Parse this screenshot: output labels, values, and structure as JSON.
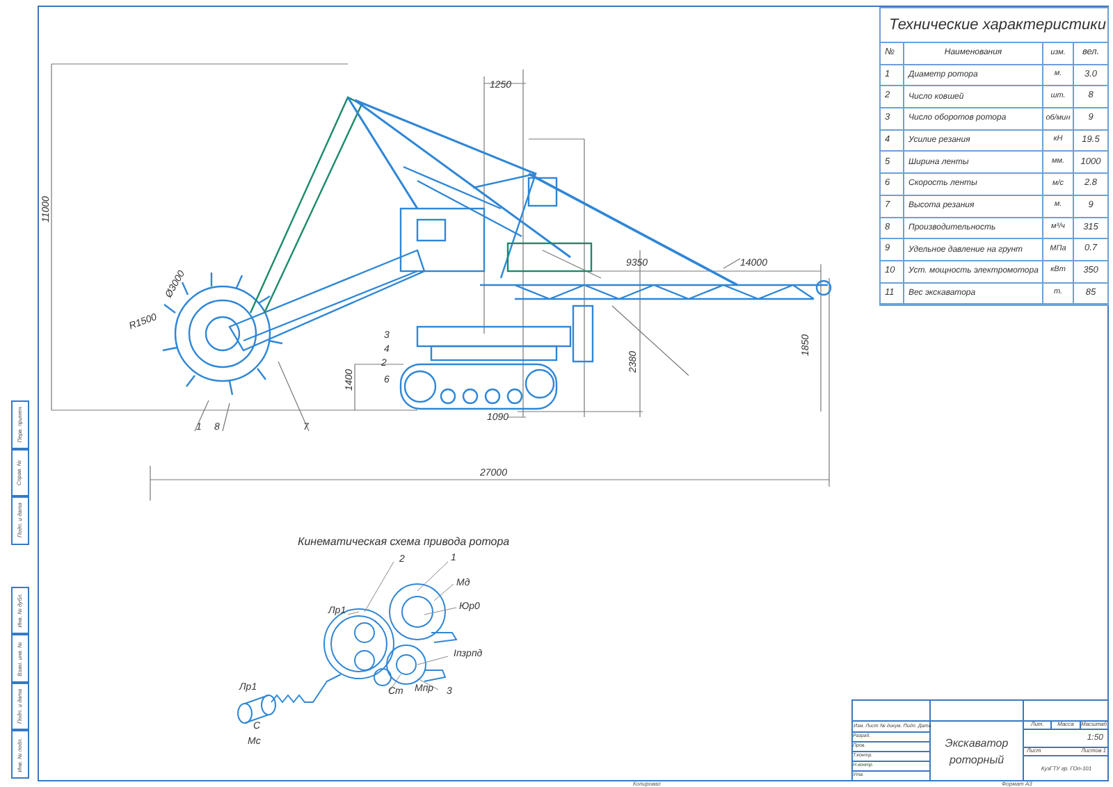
{
  "specs": {
    "title": "Технические характеристики",
    "columns": [
      "№",
      "Наименования",
      "изм.",
      "вел."
    ],
    "rows": [
      {
        "no": "1",
        "name": "Диаметр ротора",
        "unit": "м.",
        "value": "3.0"
      },
      {
        "no": "2",
        "name": "Число ковшей",
        "unit": "шт.",
        "value": "8"
      },
      {
        "no": "3",
        "name": "Число оборотов ротора",
        "unit": "об/мин",
        "value": "9"
      },
      {
        "no": "4",
        "name": "Усилие резания",
        "unit": "кН",
        "value": "19.5"
      },
      {
        "no": "5",
        "name": "Ширина ленты",
        "unit": "мм.",
        "value": "1000"
      },
      {
        "no": "6",
        "name": "Скорость ленты",
        "unit": "м/с",
        "value": "2.8"
      },
      {
        "no": "7",
        "name": "Высота резания",
        "unit": "м.",
        "value": "9"
      },
      {
        "no": "8",
        "name": "Производительность",
        "unit": "м³/ч",
        "value": "315"
      },
      {
        "no": "9",
        "name": "Удельное давление на грунт",
        "unit": "МПа",
        "value": "0.7"
      },
      {
        "no": "10",
        "name": "Уст. мощность электромотора",
        "unit": "кВт",
        "value": "350"
      },
      {
        "no": "11",
        "name": "Вес экскаватора",
        "unit": "т.",
        "value": "85"
      }
    ]
  },
  "drawing_labels": [
    "1250",
    "11000",
    "Ø3000",
    "R1500",
    "3",
    "4",
    "2",
    "6",
    "1400",
    "1090",
    "1",
    "8",
    "7",
    "27000",
    "9350",
    "14000",
    "2380",
    "1850"
  ],
  "kinematic": {
    "title": "Кинематическая схема привода ротора",
    "labels": [
      "2",
      "1",
      "Мд",
      "Юр0",
      "Лр1",
      "Iпзрпд",
      "Лр1",
      "Ст",
      "Мпр",
      "3",
      "С",
      "Мс"
    ]
  },
  "title_block": {
    "name": "Экскаватор роторный",
    "headers": [
      "Лит.",
      "Масса",
      "Масштаб"
    ],
    "scale": "1:50",
    "stamp_labels": [
      "Изм.",
      "Лист",
      "№ докум.",
      "Подп.",
      "Дата"
    ],
    "roles": [
      "Разраб.",
      "Пров.",
      "Т.контр.",
      "Н.контр.",
      "Утв."
    ],
    "sheet": "Лист",
    "sheets": "Листов 1",
    "org": "КузГТУ гр. ГОп-101"
  },
  "side_stamps": [
    "Перв. примен.",
    "Справ. №",
    "Подп. и дата",
    "Инв. № дубл.",
    "Взам. инв. №",
    "Подп. и дата",
    "Инв. № подл."
  ],
  "footer": {
    "copied": "Копировал",
    "format": "Формат A3"
  }
}
